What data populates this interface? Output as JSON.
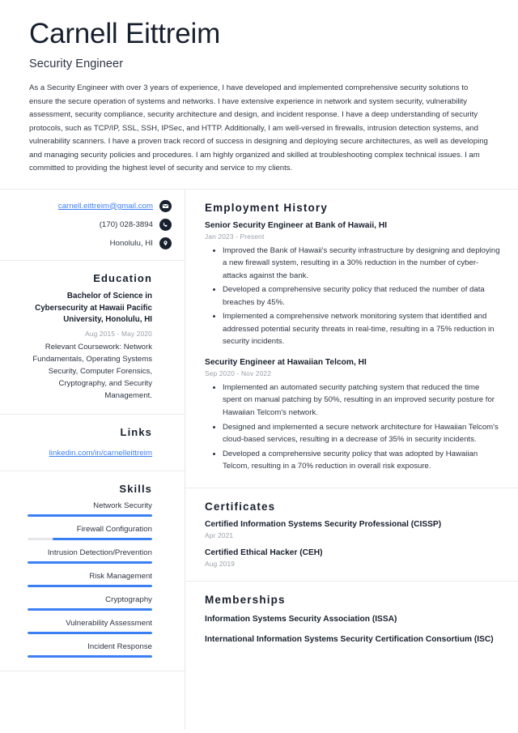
{
  "header": {
    "name": "Carnell Eittreim",
    "title": "Security Engineer",
    "summary": "As a Security Engineer with over 3 years of experience, I have developed and implemented comprehensive security solutions to ensure the secure operation of systems and networks. I have extensive experience in network and system security, vulnerability assessment, security compliance, security architecture and design, and incident response. I have a deep understanding of security protocols, such as TCP/IP, SSL, SSH, IPSec, and HTTP. Additionally, I am well-versed in firewalls, intrusion detection systems, and vulnerability scanners. I have a proven track record of success in designing and deploying secure architectures, as well as developing and managing security policies and procedures. I am highly organized and skilled at troubleshooting complex technical issues. I am committed to providing the highest level of security and service to my clients."
  },
  "contact": {
    "email": "carnell.eittreim@gmail.com",
    "email_icon": "envelope-icon",
    "phone": "(170) 028-3894",
    "phone_icon": "phone-icon",
    "location": "Honolulu, HI",
    "location_icon": "map-pin-icon"
  },
  "education": {
    "title": "Education",
    "degree": "Bachelor of Science in Cybersecurity at Hawaii Pacific University, Honolulu, HI",
    "date": "Aug 2015 - May 2020",
    "description": "Relevant Coursework: Network Fundamentals, Operating Systems Security, Computer Forensics, Cryptography, and Security Management."
  },
  "links": {
    "title": "Links",
    "items": [
      {
        "label": "linkedin.com/in/carnelleittreim"
      }
    ]
  },
  "skills": {
    "title": "Skills",
    "items": [
      {
        "label": "Network Security",
        "level": 100
      },
      {
        "label": "Firewall Configuration",
        "level": 80
      },
      {
        "label": "Intrusion Detection/Prevention",
        "level": 100
      },
      {
        "label": "Risk Management",
        "level": 100
      },
      {
        "label": "Cryptography",
        "level": 100
      },
      {
        "label": "Vulnerability Assessment",
        "level": 100
      },
      {
        "label": "Incident Response",
        "level": 100
      }
    ]
  },
  "employment": {
    "title": "Employment History",
    "jobs": [
      {
        "heading": "Senior Security Engineer at Bank of Hawaii, HI",
        "date": "Jan 2023 - Present",
        "bullets": [
          "Improved the Bank of Hawaii's security infrastructure by designing and deploying a new firewall system, resulting in a 30% reduction in the number of cyber-attacks against the bank.",
          "Developed a comprehensive security policy that reduced the number of data breaches by 45%.",
          "Implemented a comprehensive network monitoring system that identified and addressed potential security threats in real-time, resulting in a 75% reduction in security incidents."
        ]
      },
      {
        "heading": "Security Engineer at Hawaiian Telcom, HI",
        "date": "Sep 2020 - Nov 2022",
        "bullets": [
          "Implemented an automated security patching system that reduced the time spent on manual patching by 50%, resulting in an improved security posture for Hawaiian Telcom's network.",
          "Designed and implemented a secure network architecture for Hawaiian Telcom's cloud-based services, resulting in a decrease of 35% in security incidents.",
          "Developed a comprehensive security policy that was adopted by Hawaiian Telcom, resulting in a 70% reduction in overall risk exposure."
        ]
      }
    ]
  },
  "certificates": {
    "title": "Certificates",
    "items": [
      {
        "name": "Certified Information Systems Security Professional (CISSP)",
        "date": "Apr 2021"
      },
      {
        "name": "Certified Ethical Hacker (CEH)",
        "date": "Aug 2019"
      }
    ]
  },
  "memberships": {
    "title": "Memberships",
    "items": [
      {
        "name": "Information Systems Security Association (ISSA)"
      },
      {
        "name": "International Information Systems Security Certification Consortium (ISC)"
      }
    ]
  },
  "theme": {
    "accent": "#3b7ff5",
    "heading": "#17202e",
    "muted": "#9aa1ab",
    "body": "#2c3542",
    "divider": "#e9ebee",
    "track": "#e4e6ea"
  }
}
